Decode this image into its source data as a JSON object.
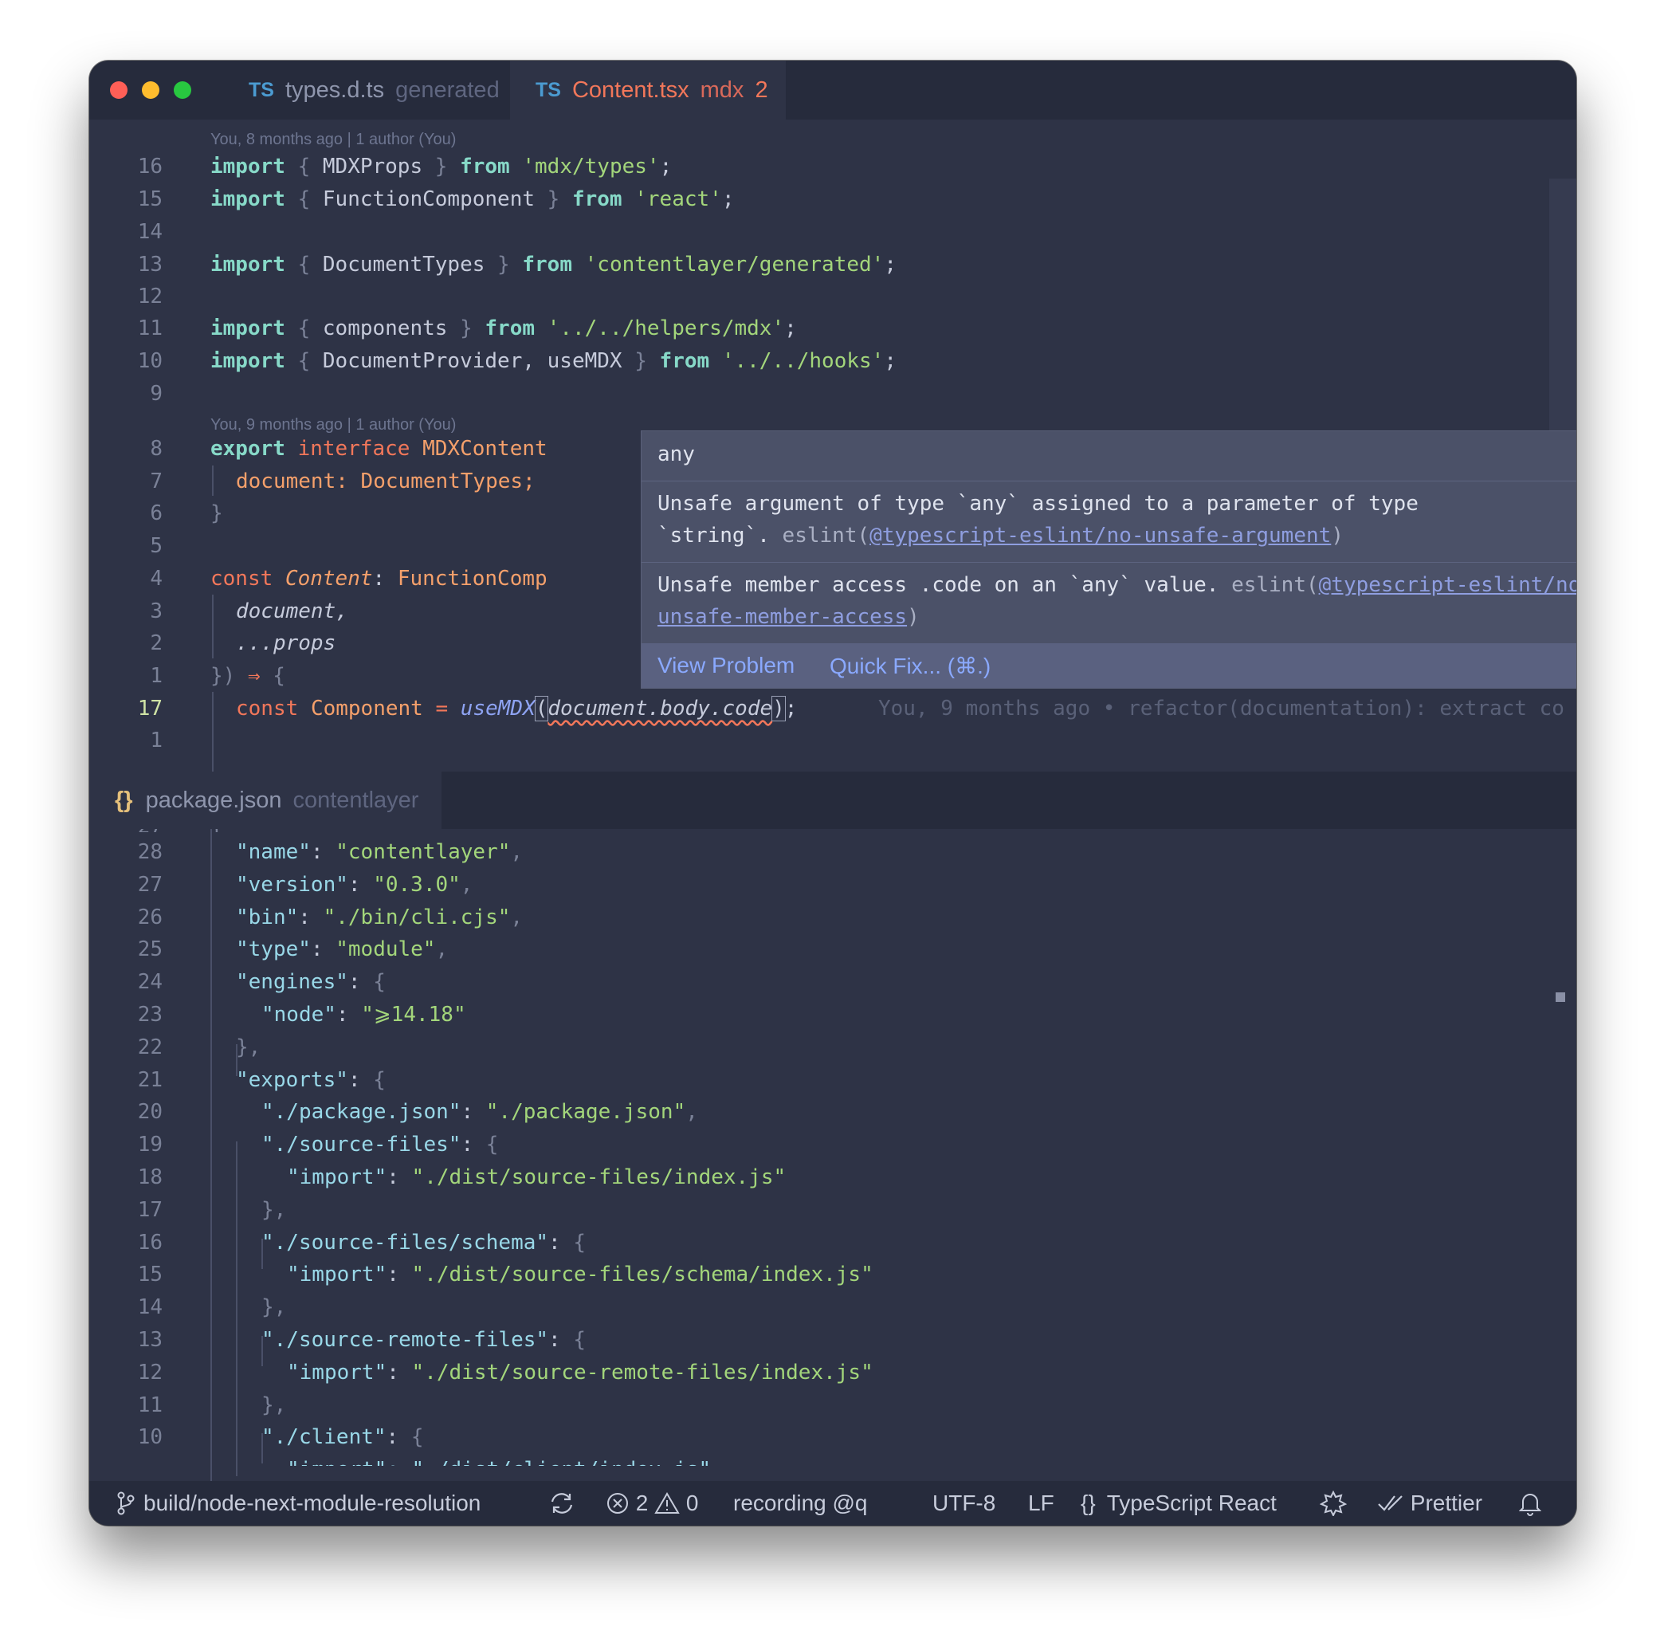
{
  "tabs": [
    {
      "lang": "TS",
      "name": "types.d.ts",
      "desc": "generated"
    },
    {
      "lang": "TS",
      "name": "Content.tsx",
      "desc": "mdx",
      "badge": "2"
    }
  ],
  "top_editor": {
    "blame1": "You, 8 months ago | 1 author (You)",
    "blame2": "You, 9 months ago | 1 author (You)",
    "line_numbers": [
      "16",
      "15",
      "14",
      "13",
      "12",
      "11",
      "10",
      "9",
      "8",
      "7",
      "6",
      "5",
      "4",
      "3",
      "2",
      "1",
      "17",
      "1"
    ],
    "lines": {
      "l16": {
        "import": "import",
        "open": "{",
        "name": "MDXProps",
        "close": "}",
        "from": "from",
        "src": "'mdx/types'",
        "semi": ";"
      },
      "l15": {
        "import": "import",
        "open": "{",
        "name": "FunctionComponent",
        "close": "}",
        "from": "from",
        "src": "'react'",
        "semi": ";"
      },
      "l13": {
        "import": "import",
        "open": "{",
        "name": "DocumentTypes",
        "close": "}",
        "from": "from",
        "src": "'contentlayer/generated'",
        "semi": ";"
      },
      "l11": {
        "import": "import",
        "open": "{",
        "name": "components",
        "close": "}",
        "from": "from",
        "src": "'../../helpers/mdx'",
        "semi": ";"
      },
      "l10": {
        "import": "import",
        "open": "{",
        "name": "DocumentProvider, useMDX",
        "close": "}",
        "from": "from",
        "src": "'../../hooks'",
        "semi": ";"
      },
      "l8": {
        "export": "export",
        "interface": "interface",
        "name": "MDXContent"
      },
      "l7": {
        "prop": "document:",
        "type": "DocumentTypes;"
      },
      "l6": "}",
      "l4": {
        "const": "const",
        "name": "Content",
        "colon": ":",
        "type": "FunctionComp"
      },
      "l3": "document,",
      "l2": "...props",
      "l1": {
        "close": "})",
        "arrow": "⇒",
        "brace": "{"
      },
      "l17": {
        "const": "const",
        "name": "Component",
        "eq": "=",
        "fn": "useMDX",
        "open": "(",
        "arg": "document.body.code",
        "close": ")",
        "semi": ";"
      },
      "inline_blame": "You, 9 months ago • refactor(documentation): extract co"
    }
  },
  "hover": {
    "type": "any",
    "msg1_a": "Unsafe argument of type `any` assigned to a parameter of type",
    "msg1_b": "`string`.",
    "msg1_src": "eslint(",
    "msg1_link": "@typescript-eslint/no-unsafe-argument",
    "msg1_end": ")",
    "msg2_a": "Unsafe member access .code on an `any` value.",
    "msg2_src": "eslint(",
    "msg2_link1": "@typescript-eslint/no-",
    "msg2_link2": "unsafe-member-access",
    "msg2_end": ")",
    "view_problem": "View Problem",
    "quick_fix": "Quick Fix... (⌘.)"
  },
  "bottom_editor": {
    "tab_icon": "{}",
    "tab_name": "package.json",
    "tab_desc": "contentlayer",
    "line_numbers": [
      "28",
      "27",
      "26",
      "25",
      "24",
      "23",
      "22",
      "21",
      "20",
      "19",
      "18",
      "17",
      "16",
      "15",
      "14",
      "13",
      "12",
      "11",
      "10"
    ],
    "rows": [
      {
        "k": "\"name\"",
        "v": "\"contentlayer\"",
        "end": ","
      },
      {
        "k": "\"version\"",
        "v": "\"0.3.0\"",
        "end": ","
      },
      {
        "k": "\"bin\"",
        "v": "\"./bin/cli.cjs\"",
        "end": ","
      },
      {
        "k": "\"type\"",
        "v": "\"module\"",
        "end": ","
      },
      {
        "k": "\"engines\"",
        "v": "",
        "end": "{"
      },
      {
        "k": "\"node\"",
        "v": "\"⩾14.18\"",
        "end": ""
      },
      {
        "k": "",
        "v": "",
        "end": "},"
      },
      {
        "k": "\"exports\"",
        "v": "",
        "end": "{"
      },
      {
        "k": "\"./package.json\"",
        "v": "\"./package.json\"",
        "end": ","
      },
      {
        "k": "\"./source-files\"",
        "v": "",
        "end": "{"
      },
      {
        "k": "\"import\"",
        "v": "\"./dist/source-files/index.js\"",
        "end": ""
      },
      {
        "k": "",
        "v": "",
        "end": "},"
      },
      {
        "k": "\"./source-files/schema\"",
        "v": "",
        "end": "{"
      },
      {
        "k": "\"import\"",
        "v": "\"./dist/source-files/schema/index.js\"",
        "end": ""
      },
      {
        "k": "",
        "v": "",
        "end": "},"
      },
      {
        "k": "\"./source-remote-files\"",
        "v": "",
        "end": "{"
      },
      {
        "k": "\"import\"",
        "v": "\"./dist/source-remote-files/index.js\"",
        "end": ""
      },
      {
        "k": "",
        "v": "",
        "end": "},"
      },
      {
        "k": "\"./client\"",
        "v": "",
        "end": "{"
      }
    ]
  },
  "statusbar": {
    "branch": "build/node-next-module-resolution",
    "errors": "2",
    "warnings": "0",
    "recording": "recording @q",
    "encoding": "UTF-8",
    "eol": "LF",
    "lang_icon": "{}",
    "language": "TypeScript React",
    "formatter": "Prettier"
  },
  "colors": {
    "error": "#f2775a",
    "keyword": "#87d9c8",
    "string": "#a3d67b",
    "link": "#8f9ee0",
    "active_line_number": "#cfe3a5"
  },
  "icons": [
    "git-branch-icon",
    "sync-icon",
    "error-icon",
    "warning-icon",
    "braces-icon",
    "copilot-icon",
    "check-icon",
    "bell-icon"
  ]
}
